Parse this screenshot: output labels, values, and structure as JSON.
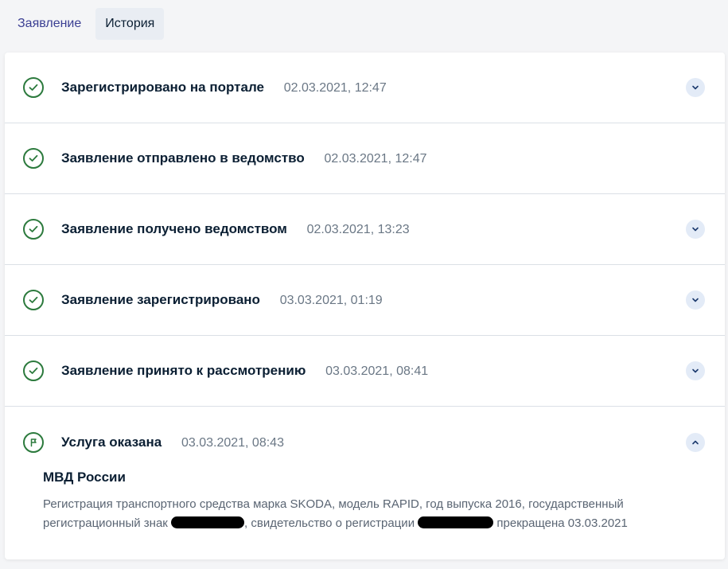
{
  "tabs": [
    {
      "label": "Заявление",
      "active": false
    },
    {
      "label": "История",
      "active": true
    }
  ],
  "history": [
    {
      "title": "Зарегистрировано на портале",
      "date": "02.03.2021, 12:47",
      "icon": "check-circle-icon",
      "expandable": true
    },
    {
      "title": "Заявление отправлено в ведомство",
      "date": "02.03.2021, 12:47",
      "icon": "check-circle-icon",
      "expandable": false
    },
    {
      "title": "Заявление получено ведомством",
      "date": "02.03.2021, 13:23",
      "icon": "check-circle-icon",
      "expandable": true
    },
    {
      "title": "Заявление зарегистрировано",
      "date": "03.03.2021, 01:19",
      "icon": "check-circle-icon",
      "expandable": true
    },
    {
      "title": "Заявление принято к рассмотрению",
      "date": "03.03.2021, 08:41",
      "icon": "check-circle-icon",
      "expandable": true
    },
    {
      "title": "Услуга оказана",
      "date": "03.03.2021, 08:43",
      "icon": "flag-circle-icon",
      "expandable": true,
      "expanded": true
    }
  ],
  "detail": {
    "agency": "МВД России",
    "text_part1": "Регистрация транспортного средства марка SKODA, модель RAPID, год выпуска 2016, государственный регистрационный знак",
    "text_part2": ", свидетельство о регистрации",
    "text_part3": "прекращена 03.03.2021"
  },
  "colors": {
    "accent_link": "#3b3f93",
    "success": "#2c7a3d",
    "muted_text": "#6a7785",
    "chevron_bg": "#e3ebf7"
  }
}
